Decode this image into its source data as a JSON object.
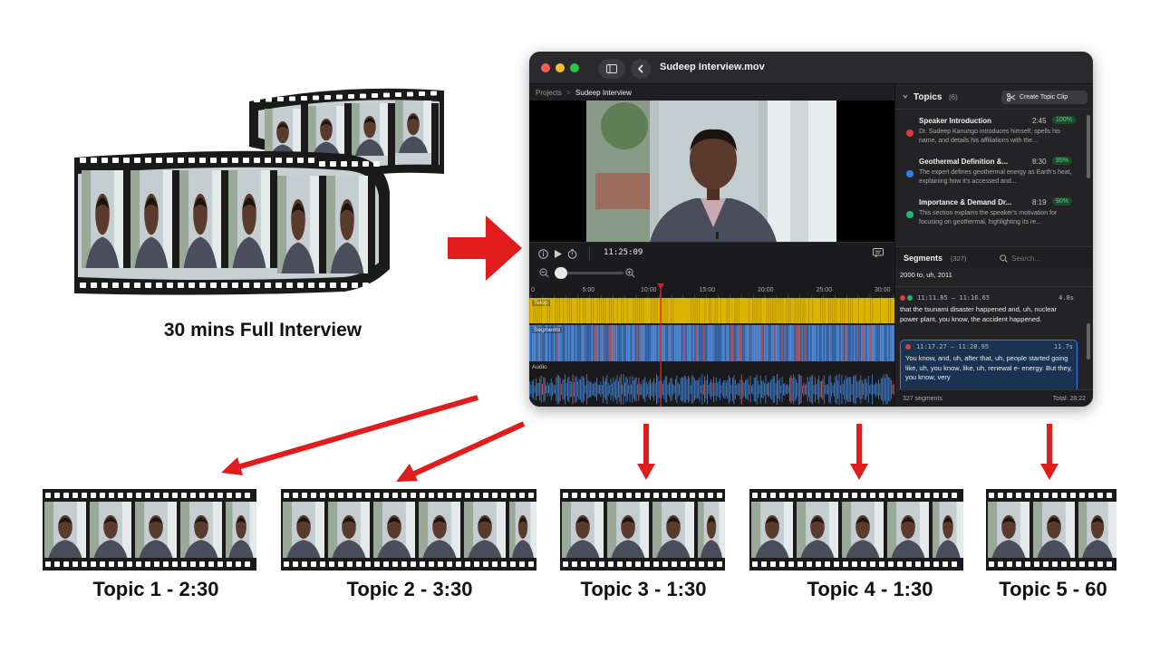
{
  "source": {
    "caption": "30 mins Full Interview"
  },
  "window": {
    "title": "Sudeep Interview.mov",
    "breadcrumb": {
      "root": "Projects",
      "separator": ">",
      "current": "Sudeep Interview"
    },
    "sidebar_icon": "sidebar-toggle-icon",
    "back_icon": "chevron-left-icon"
  },
  "player": {
    "timecode": "11:25:09",
    "controls": [
      "info-icon",
      "play-icon",
      "timer-icon"
    ],
    "comment_icon": "comment-icon"
  },
  "timeline": {
    "ruler": [
      "0",
      "5:00",
      "10:00",
      "15:00",
      "20:00",
      "25:00",
      "30:00"
    ],
    "tracks": {
      "telop": "Telop",
      "segments": "Segments",
      "audio": "Audio"
    },
    "colors": {
      "telop": "#d9b400",
      "segments": "#3b6fb4",
      "audio": "#3f79c2",
      "playhead": "#e02020"
    },
    "playhead_fraction": 0.36
  },
  "topics_panel": {
    "title": "Topics",
    "count": "(6)",
    "create_button": "Create Topic Clip",
    "items": [
      {
        "title": "Speaker Introduction",
        "duration": "2:45",
        "score": "100%",
        "color": "#e03a3a",
        "description": "Dr. Sudeep Kanungo introduces himself, spells his name, and details his affiliations with the..."
      },
      {
        "title": "Geothermal Definition &...",
        "duration": "8:30",
        "score": "95%",
        "color": "#2f7fe0",
        "description": "The expert defines geothermal energy as Earth's heat, explaining how it's accessed and..."
      },
      {
        "title": "Importance & Demand Dr...",
        "duration": "8:19",
        "score": "90%",
        "color": "#22b573",
        "description": "This section explains the speaker's motivation for focusing on geothermal, highlighting its re..."
      }
    ]
  },
  "segments_panel": {
    "title": "Segments",
    "count": "(327)",
    "search_placeholder": "Search...",
    "items": [
      {
        "time": "",
        "duration": "",
        "text": "2000 to, uh, 2011"
      },
      {
        "time": "11:11.85 – 11:16.65",
        "duration": "4.8s",
        "text": "that the tsunami disaster happened and, uh, nuclear power plant, you know, the accident happened."
      },
      {
        "time": "11:17.27 – 11:28.95",
        "duration": "11.7s",
        "text": "You know, and, uh, after that, uh, people started going like, uh, you know, like, uh, renewal e- energy. But they, you know, very"
      }
    ],
    "footer_left": "327 segments",
    "footer_right": "Total: 28:22"
  },
  "clips": [
    {
      "label": "Topic 1 - 2:30"
    },
    {
      "label": "Topic 2 - 3:30"
    },
    {
      "label": "Topic 3 - 1:30"
    },
    {
      "label": "Topic 4 - 1:30"
    },
    {
      "label": "Topic 5 - 60"
    }
  ],
  "colors": {
    "arrow": "#e01c1c",
    "film": "#1a1a1a",
    "frame_bg": "#c9d3d6",
    "suit": "#4a4d5c",
    "skin": "#5a3a2c"
  }
}
